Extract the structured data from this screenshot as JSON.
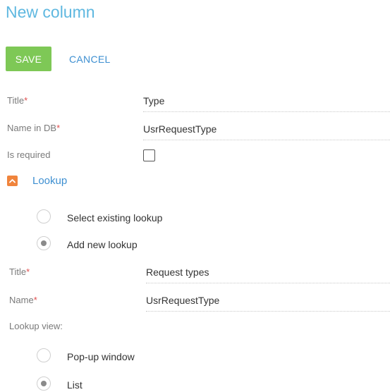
{
  "page": {
    "title": "New column"
  },
  "toolbar": {
    "save_label": "SAVE",
    "cancel_label": "CANCEL"
  },
  "column_form": {
    "title_label": "Title",
    "title_value": "Type",
    "name_in_db_label": "Name in DB",
    "name_in_db_value": "UsrRequestType",
    "is_required_label": "Is required",
    "is_required_checked": false,
    "required_marker": "*"
  },
  "lookup_section": {
    "header_label": "Lookup",
    "toggle_icon": "chevron-up-icon",
    "options": [
      {
        "label": "Select existing lookup",
        "selected": false
      },
      {
        "label": "Add new lookup",
        "selected": true
      }
    ],
    "title_label": "Title",
    "title_value": "Request types",
    "name_label": "Name",
    "name_value": "UsrRequestType",
    "view_label": "Lookup view:",
    "view_options": [
      {
        "label": "Pop-up window",
        "selected": false
      },
      {
        "label": "List",
        "selected": true
      }
    ]
  },
  "colors": {
    "title": "#5fb8e0",
    "save_button": "#7ec856",
    "link": "#3d8fd1",
    "toggle": "#f0843c",
    "required": "#e05050"
  }
}
